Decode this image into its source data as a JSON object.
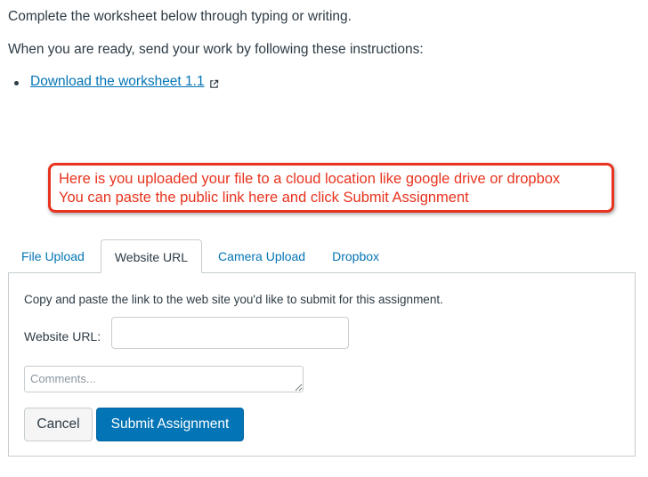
{
  "content": {
    "intro_text": "Complete the worksheet below through typing or writing.",
    "instructions_text": "When you are ready, send your work by following these instructions:",
    "download_link_label": "Download the worksheet 1.1"
  },
  "callout": {
    "line1": "Here is you uploaded your file to a cloud location like google drive or dropbox",
    "line2": "You can paste the public link here and click Submit Assignment",
    "color": "#e8331e"
  },
  "tabs": [
    {
      "label": "File Upload",
      "active": false
    },
    {
      "label": "Website URL",
      "active": true
    },
    {
      "label": "Camera Upload",
      "active": false
    },
    {
      "label": "Dropbox",
      "active": false
    }
  ],
  "panel": {
    "description": "Copy and paste the link to the web site you'd like to submit for this assignment.",
    "url_label": "Website URL:",
    "url_value": "",
    "comments_placeholder": "Comments...",
    "cancel_label": "Cancel",
    "submit_label": "Submit Assignment"
  },
  "colors": {
    "link": "#0374b5",
    "text": "#2d3b45",
    "primary_button": "#0374b5",
    "border": "#c7cdd1"
  },
  "icons": {
    "external_link": "external-link-icon"
  }
}
